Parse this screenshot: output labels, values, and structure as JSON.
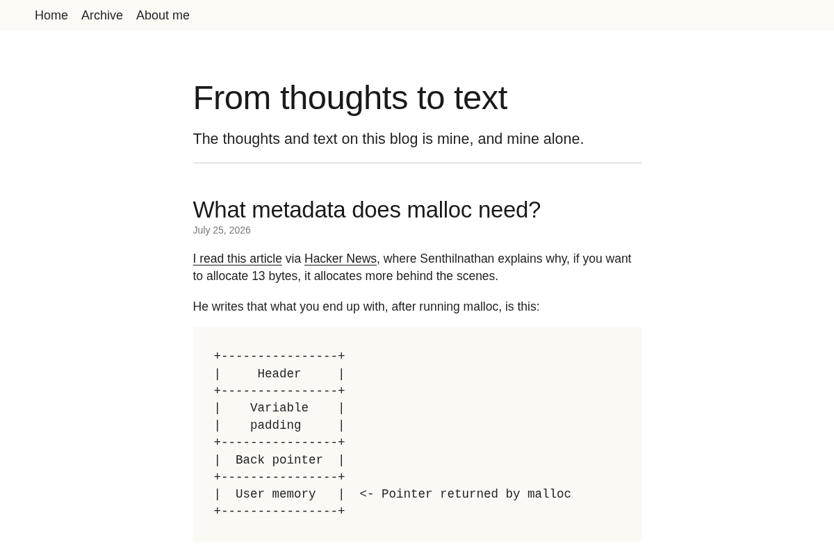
{
  "nav": {
    "links": [
      "Home",
      "Archive",
      "About me"
    ]
  },
  "blog": {
    "title": "From thoughts to text",
    "tagline": "The thoughts and text on this blog is mine, and mine alone."
  },
  "post": {
    "title": "What metadata does malloc need?",
    "date": "July 25, 2026",
    "paragraphs": [
      {
        "parts": [
          {
            "kind": "link",
            "text": "I read this article"
          },
          {
            "kind": "text",
            "text": " via "
          },
          {
            "kind": "link",
            "text": "Hacker News"
          },
          {
            "kind": "text",
            "text": ", where Senthilnathan explains why, if you want to allocate 13 bytes, it allocates more behind the scenes."
          }
        ]
      },
      {
        "parts": [
          {
            "kind": "text",
            "text": "He writes that what you end up with, after running malloc, is this:"
          }
        ]
      }
    ],
    "code_block": {
      "lines": [
        "+----------------+",
        "|     Header     |",
        "+----------------+",
        "|    Variable    |",
        "|    padding     |",
        "+----------------+",
        "|  Back pointer  |",
        "+----------------+",
        "|  User memory   |  <- Pointer returned by malloc",
        "+----------------+"
      ]
    }
  }
}
